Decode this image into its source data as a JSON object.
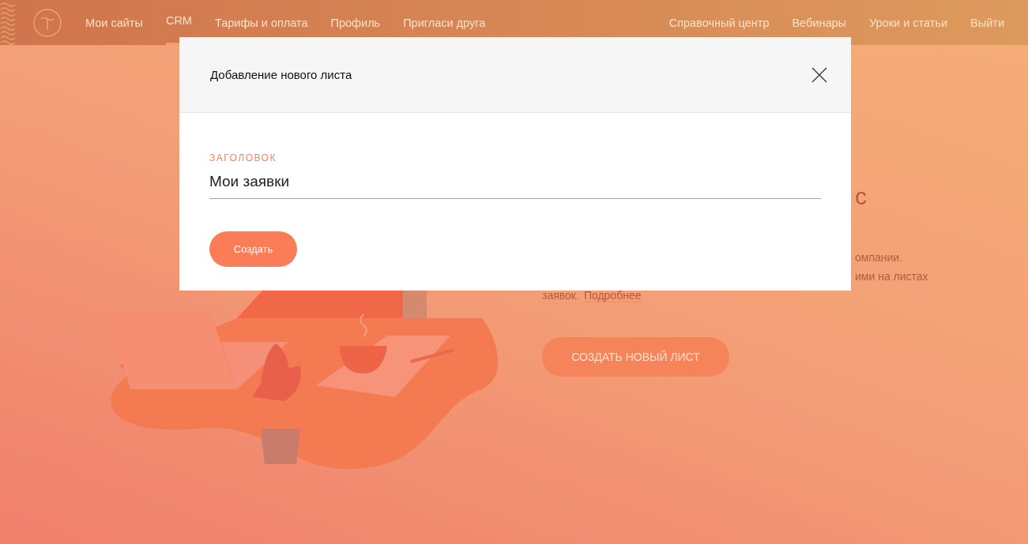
{
  "nav": {
    "left_items": [
      {
        "label": "Мои сайты",
        "selected": false
      },
      {
        "label": "CRM",
        "selected": true
      },
      {
        "label": "Тарифы и оплата",
        "selected": false
      },
      {
        "label": "Профиль",
        "selected": false
      },
      {
        "label": "Пригласи друга",
        "selected": false
      }
    ],
    "right_items": [
      {
        "label": "Справочный центр",
        "selected": false
      },
      {
        "label": "Вебинары",
        "selected": false
      },
      {
        "label": "Уроки и статьи",
        "selected": false
      },
      {
        "label": "Выйти",
        "selected": false
      }
    ]
  },
  "background": {
    "heading_fragment": "с",
    "paragraph_fragments": [
      "омпании.",
      "ими на листах"
    ],
    "paragraph_last": "заявок.",
    "more_link": "Подробнее",
    "create_button": "СОЗДАТЬ НОВЫЙ ЛИСТ"
  },
  "modal": {
    "title": "Добавление нового листа",
    "field": {
      "label": "ЗАГОЛОВОК",
      "value": "Мои заявки"
    },
    "submit_button": "Создать"
  }
}
